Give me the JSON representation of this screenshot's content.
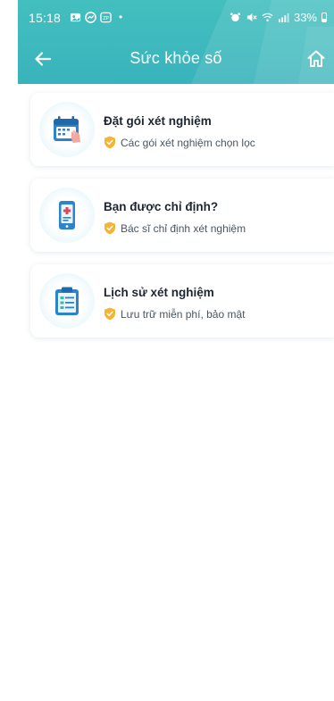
{
  "status_bar": {
    "time": "15:18",
    "battery": "33%",
    "icons": [
      "gallery-icon",
      "messenger-icon",
      "zalo-icon",
      "alarm-icon",
      "mute-icon",
      "wifi-icon",
      "signal-icon",
      "battery-icon"
    ],
    "dot": "•"
  },
  "header": {
    "title": "Sức khỏe số",
    "back_icon": "arrow-left-icon",
    "home_icon": "home-icon",
    "color": "#3dbabd"
  },
  "cards": [
    {
      "title": "Đặt gói xét nghiệm",
      "subtitle": "Các gói xét nghiệm chọn lọc",
      "icon": "calendar-icon"
    },
    {
      "title": "Bạn được chỉ định?",
      "subtitle": "Bác sĩ chỉ định xét nghiệm",
      "icon": "medical-tablet-icon"
    },
    {
      "title": "Lịch sử xét nghiệm",
      "subtitle": "Lưu trữ miễn phí, bảo mật",
      "icon": "clipboard-icon"
    }
  ],
  "colors": {
    "shield": "#f2b53a",
    "card_title": "#1d2530",
    "card_subtitle": "#4a5560",
    "icon_blue": "#2d84c9"
  }
}
